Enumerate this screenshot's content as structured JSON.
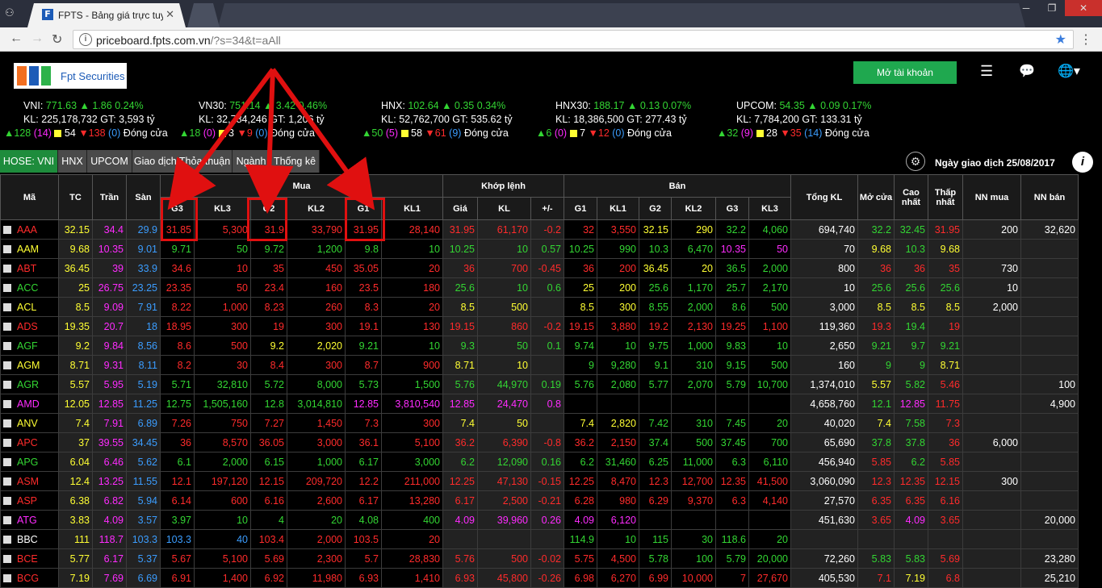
{
  "browser": {
    "tab_title": "FPTS - Bảng giá trực tuyế",
    "url_host": "priceboard.fpts.com.vn",
    "url_path": "/?s=34&t=aAll"
  },
  "header": {
    "logo_text": "Fpt Securities",
    "open_account": "Mở tài khoản"
  },
  "indices": [
    {
      "name": "VNI:",
      "value": "771.63",
      "chg": "▲ 1.86",
      "pct": "0.24%",
      "kl": "KL: 225,178,732 GT: 3,593 tỷ",
      "inc": "▲128",
      "ce": "(14)",
      "ref": "54",
      "dec": "▼138",
      "fl": "(0)",
      "status": "Đóng cửa"
    },
    {
      "name": "VN30:",
      "value": "751.14",
      "chg": "▲ 3.42",
      "pct": "0.46%",
      "kl": "KL: 32,784,246 GT: 1,206 tỷ",
      "inc": "▲18",
      "ce": "(0)",
      "ref": "3",
      "dec": "▼9",
      "fl": "(0)",
      "status": "Đóng cửa"
    },
    {
      "name": "HNX:",
      "value": "102.64",
      "chg": "▲ 0.35",
      "pct": "0.34%",
      "kl": "KL: 52,762,700 GT: 535.62 tỷ",
      "inc": "▲50",
      "ce": "(5)",
      "ref": "58",
      "dec": "▼61",
      "fl": "(9)",
      "status": "Đóng cửa"
    },
    {
      "name": "HNX30:",
      "value": "188.17",
      "chg": "▲ 0.13",
      "pct": "0.07%",
      "kl": "KL: 18,386,500 GT: 277.43 tỷ",
      "inc": "▲6",
      "ce": "(0)",
      "ref": "7",
      "dec": "▼12",
      "fl": "(0)",
      "status": "Đóng cửa"
    },
    {
      "name": "UPCOM:",
      "value": "54.35",
      "chg": "▲ 0.09",
      "pct": "0.17%",
      "kl": "KL: 7,784,200 GT: 133.31 tỷ",
      "inc": "▲32",
      "ce": "(9)",
      "ref": "28",
      "dec": "▼35",
      "fl": "(14)",
      "status": "Đóng cửa"
    }
  ],
  "tabs": [
    "HOSE: VNI",
    "HNX",
    "UPCOM",
    "Giao dịch Thỏa thuận",
    "Ngành",
    "Thống kê"
  ],
  "trade_date": "Ngày giao dịch 25/08/2017",
  "columns": {
    "ma": "Mã",
    "tc": "TC",
    "tran": "Trần",
    "san": "Sàn",
    "mua": "Mua",
    "khop": "Khớp lệnh",
    "ban": "Bán",
    "tong": "Tổng KL",
    "mo": "Mở cửa",
    "cao": "Cao nhất",
    "thap": "Thấp nhất",
    "nnmua": "NN mua",
    "nnban": "NN bán",
    "g3": "G3",
    "kl3": "KL3",
    "g2": "G2",
    "kl2": "KL2",
    "g1": "G1",
    "kl1": "KL1",
    "gia": "Giá",
    "kl": "KL",
    "pm": "+/-"
  },
  "rows": [
    [
      "AAA",
      "32.15",
      "34.4",
      "29.9",
      "31.85",
      "5,300",
      "31.9",
      "33,790",
      "31.95",
      "28,140",
      "31.95",
      "61,170",
      "-0.2",
      "32",
      "3,550",
      "32.15",
      "290",
      "32.2",
      "4,060",
      "694,740",
      "32.2",
      "32.45",
      "31.95",
      "200",
      "32,620"
    ],
    [
      "AAM",
      "9.68",
      "10.35",
      "9.01",
      "9.71",
      "50",
      "9.72",
      "1,200",
      "9.8",
      "10",
      "10.25",
      "10",
      "0.57",
      "10.25",
      "990",
      "10.3",
      "6,470",
      "10.35",
      "50",
      "70",
      "9.68",
      "10.3",
      "9.68",
      "",
      ""
    ],
    [
      "ABT",
      "36.45",
      "39",
      "33.9",
      "34.6",
      "10",
      "35",
      "450",
      "35.05",
      "20",
      "36",
      "700",
      "-0.45",
      "36",
      "200",
      "36.45",
      "20",
      "36.5",
      "2,000",
      "800",
      "36",
      "36",
      "35",
      "730",
      ""
    ],
    [
      "ACC",
      "25",
      "26.75",
      "23.25",
      "23.35",
      "50",
      "23.4",
      "160",
      "23.5",
      "180",
      "25.6",
      "10",
      "0.6",
      "25",
      "200",
      "25.6",
      "1,170",
      "25.7",
      "2,170",
      "10",
      "25.6",
      "25.6",
      "25.6",
      "10",
      ""
    ],
    [
      "ACL",
      "8.5",
      "9.09",
      "7.91",
      "8.22",
      "1,000",
      "8.23",
      "260",
      "8.3",
      "20",
      "8.5",
      "500",
      "",
      "8.5",
      "300",
      "8.55",
      "2,000",
      "8.6",
      "500",
      "3,000",
      "8.5",
      "8.5",
      "8.5",
      "2,000",
      ""
    ],
    [
      "ADS",
      "19.35",
      "20.7",
      "18",
      "18.95",
      "300",
      "19",
      "300",
      "19.1",
      "130",
      "19.15",
      "860",
      "-0.2",
      "19.15",
      "3,880",
      "19.2",
      "2,130",
      "19.25",
      "1,100",
      "119,360",
      "19.3",
      "19.4",
      "19",
      "",
      ""
    ],
    [
      "AGF",
      "9.2",
      "9.84",
      "8.56",
      "8.6",
      "500",
      "9.2",
      "2,020",
      "9.21",
      "10",
      "9.3",
      "50",
      "0.1",
      "9.74",
      "10",
      "9.75",
      "1,000",
      "9.83",
      "10",
      "2,650",
      "9.21",
      "9.7",
      "9.21",
      "",
      ""
    ],
    [
      "AGM",
      "8.71",
      "9.31",
      "8.11",
      "8.2",
      "30",
      "8.4",
      "300",
      "8.7",
      "900",
      "8.71",
      "10",
      "",
      "9",
      "9,280",
      "9.1",
      "310",
      "9.15",
      "500",
      "160",
      "9",
      "9",
      "8.71",
      "",
      ""
    ],
    [
      "AGR",
      "5.57",
      "5.95",
      "5.19",
      "5.71",
      "32,810",
      "5.72",
      "8,000",
      "5.73",
      "1,500",
      "5.76",
      "44,970",
      "0.19",
      "5.76",
      "2,080",
      "5.77",
      "2,070",
      "5.79",
      "10,700",
      "1,374,010",
      "5.57",
      "5.82",
      "5.46",
      "",
      "100"
    ],
    [
      "AMD",
      "12.05",
      "12.85",
      "11.25",
      "12.75",
      "1,505,160",
      "12.8",
      "3,014,810",
      "12.85",
      "3,810,540",
      "12.85",
      "24,470",
      "0.8",
      "",
      "",
      "",
      "",
      "",
      "",
      "4,658,760",
      "12.1",
      "12.85",
      "11.75",
      "",
      "4,900"
    ],
    [
      "ANV",
      "7.4",
      "7.91",
      "6.89",
      "7.26",
      "750",
      "7.27",
      "1,450",
      "7.3",
      "300",
      "7.4",
      "50",
      "",
      "7.4",
      "2,820",
      "7.42",
      "310",
      "7.45",
      "20",
      "40,020",
      "7.4",
      "7.58",
      "7.3",
      "",
      ""
    ],
    [
      "APC",
      "37",
      "39.55",
      "34.45",
      "36",
      "8,570",
      "36.05",
      "3,000",
      "36.1",
      "5,100",
      "36.2",
      "6,390",
      "-0.8",
      "36.2",
      "2,150",
      "37.4",
      "500",
      "37.45",
      "700",
      "65,690",
      "37.8",
      "37.8",
      "36",
      "6,000",
      ""
    ],
    [
      "APG",
      "6.04",
      "6.46",
      "5.62",
      "6.1",
      "2,000",
      "6.15",
      "1,000",
      "6.17",
      "3,000",
      "6.2",
      "12,090",
      "0.16",
      "6.2",
      "31,460",
      "6.25",
      "11,000",
      "6.3",
      "6,110",
      "456,940",
      "5.85",
      "6.2",
      "5.85",
      "",
      ""
    ],
    [
      "ASM",
      "12.4",
      "13.25",
      "11.55",
      "12.1",
      "197,120",
      "12.15",
      "209,720",
      "12.2",
      "211,000",
      "12.25",
      "47,130",
      "-0.15",
      "12.25",
      "8,470",
      "12.3",
      "12,700",
      "12.35",
      "41,500",
      "3,060,090",
      "12.3",
      "12.35",
      "12.15",
      "300",
      ""
    ],
    [
      "ASP",
      "6.38",
      "6.82",
      "5.94",
      "6.14",
      "600",
      "6.16",
      "2,600",
      "6.17",
      "13,280",
      "6.17",
      "2,500",
      "-0.21",
      "6.28",
      "980",
      "6.29",
      "9,370",
      "6.3",
      "4,140",
      "27,570",
      "6.35",
      "6.35",
      "6.16",
      "",
      ""
    ],
    [
      "ATG",
      "3.83",
      "4.09",
      "3.57",
      "3.97",
      "10",
      "4",
      "20",
      "4.08",
      "400",
      "4.09",
      "39,960",
      "0.26",
      "4.09",
      "6,120",
      "",
      "",
      "",
      "",
      "451,630",
      "3.65",
      "4.09",
      "3.65",
      "",
      "20,000"
    ],
    [
      "BBC",
      "111",
      "118.7",
      "103.3",
      "103.3",
      "40",
      "103.4",
      "2,000",
      "103.5",
      "20",
      "",
      "",
      "",
      "114.9",
      "10",
      "115",
      "30",
      "118.6",
      "20",
      "",
      "",
      "",
      "",
      "",
      ""
    ],
    [
      "BCE",
      "5.77",
      "6.17",
      "5.37",
      "5.67",
      "5,100",
      "5.69",
      "2,300",
      "5.7",
      "28,830",
      "5.76",
      "500",
      "-0.02",
      "5.75",
      "4,500",
      "5.78",
      "100",
      "5.79",
      "20,000",
      "72,260",
      "5.83",
      "5.83",
      "5.69",
      "",
      "23,280"
    ],
    [
      "BCG",
      "7.19",
      "7.69",
      "6.69",
      "6.91",
      "1,400",
      "6.92",
      "11,980",
      "6.93",
      "1,410",
      "6.93",
      "45,800",
      "-0.26",
      "6.98",
      "6,270",
      "6.99",
      "10,000",
      "7",
      "27,670",
      "405,530",
      "7.1",
      "7.19",
      "6.8",
      "",
      "25,210"
    ]
  ],
  "colors": [
    "r",
    "y",
    "c",
    "f",
    "r",
    "r",
    "r",
    "r",
    "r",
    "r",
    "r",
    "r",
    "r",
    "r",
    "r",
    "r",
    "r",
    "r",
    "r",
    "w",
    "r",
    "r",
    "r",
    "w",
    "w"
  ],
  "row_colors": [
    [
      "r",
      "y",
      "c",
      "f",
      "r",
      "r",
      "r",
      "r",
      "r",
      "r",
      "r",
      "r",
      "r",
      "r",
      "r",
      "y",
      "y",
      "g",
      "g",
      "w",
      "g",
      "g",
      "r",
      "w",
      "w"
    ],
    [
      "y",
      "y",
      "c",
      "f",
      "g",
      "g",
      "g",
      "g",
      "g",
      "g",
      "g",
      "g",
      "g",
      "g",
      "g",
      "g",
      "g",
      "c",
      "c",
      "w",
      "y",
      "g",
      "y",
      "w",
      "w"
    ],
    [
      "r",
      "y",
      "c",
      "f",
      "r",
      "r",
      "r",
      "r",
      "r",
      "r",
      "r",
      "r",
      "r",
      "r",
      "r",
      "y",
      "y",
      "g",
      "g",
      "w",
      "r",
      "r",
      "r",
      "w",
      "w"
    ],
    [
      "g",
      "y",
      "c",
      "f",
      "r",
      "r",
      "r",
      "r",
      "r",
      "r",
      "g",
      "g",
      "g",
      "y",
      "y",
      "g",
      "g",
      "g",
      "g",
      "w",
      "g",
      "g",
      "g",
      "w",
      "w"
    ],
    [
      "y",
      "y",
      "c",
      "f",
      "r",
      "r",
      "r",
      "r",
      "r",
      "r",
      "y",
      "y",
      "y",
      "y",
      "y",
      "g",
      "g",
      "g",
      "g",
      "w",
      "y",
      "y",
      "y",
      "w",
      "w"
    ],
    [
      "r",
      "y",
      "c",
      "f",
      "r",
      "r",
      "r",
      "r",
      "r",
      "r",
      "r",
      "r",
      "r",
      "r",
      "r",
      "r",
      "r",
      "r",
      "r",
      "w",
      "r",
      "g",
      "r",
      "w",
      "w"
    ],
    [
      "g",
      "y",
      "c",
      "f",
      "r",
      "r",
      "y",
      "y",
      "g",
      "g",
      "g",
      "g",
      "g",
      "g",
      "g",
      "g",
      "g",
      "g",
      "g",
      "w",
      "g",
      "g",
      "g",
      "w",
      "w"
    ],
    [
      "y",
      "y",
      "c",
      "f",
      "r",
      "r",
      "r",
      "r",
      "r",
      "r",
      "y",
      "y",
      "y",
      "g",
      "g",
      "g",
      "g",
      "g",
      "g",
      "w",
      "g",
      "g",
      "y",
      "w",
      "w"
    ],
    [
      "g",
      "y",
      "c",
      "f",
      "g",
      "g",
      "g",
      "g",
      "g",
      "g",
      "g",
      "g",
      "g",
      "g",
      "g",
      "g",
      "g",
      "g",
      "g",
      "w",
      "y",
      "g",
      "r",
      "w",
      "w"
    ],
    [
      "c",
      "y",
      "c",
      "f",
      "g",
      "g",
      "g",
      "g",
      "c",
      "c",
      "c",
      "c",
      "c",
      "w",
      "w",
      "w",
      "w",
      "w",
      "w",
      "w",
      "g",
      "c",
      "r",
      "w",
      "w"
    ],
    [
      "y",
      "y",
      "c",
      "f",
      "r",
      "r",
      "r",
      "r",
      "r",
      "r",
      "y",
      "y",
      "y",
      "y",
      "y",
      "g",
      "g",
      "g",
      "g",
      "w",
      "y",
      "g",
      "r",
      "w",
      "w"
    ],
    [
      "r",
      "y",
      "c",
      "f",
      "r",
      "r",
      "r",
      "r",
      "r",
      "r",
      "r",
      "r",
      "r",
      "r",
      "r",
      "g",
      "g",
      "g",
      "g",
      "w",
      "g",
      "g",
      "r",
      "w",
      "w"
    ],
    [
      "g",
      "y",
      "c",
      "f",
      "g",
      "g",
      "g",
      "g",
      "g",
      "g",
      "g",
      "g",
      "g",
      "g",
      "g",
      "g",
      "g",
      "g",
      "g",
      "w",
      "r",
      "g",
      "r",
      "w",
      "w"
    ],
    [
      "r",
      "y",
      "c",
      "f",
      "r",
      "r",
      "r",
      "r",
      "r",
      "r",
      "r",
      "r",
      "r",
      "r",
      "r",
      "r",
      "r",
      "r",
      "r",
      "w",
      "r",
      "r",
      "r",
      "w",
      "w"
    ],
    [
      "r",
      "y",
      "c",
      "f",
      "r",
      "r",
      "r",
      "r",
      "r",
      "r",
      "r",
      "r",
      "r",
      "r",
      "r",
      "r",
      "r",
      "r",
      "r",
      "w",
      "r",
      "r",
      "r",
      "w",
      "w"
    ],
    [
      "c",
      "y",
      "c",
      "f",
      "g",
      "g",
      "g",
      "g",
      "g",
      "g",
      "c",
      "c",
      "c",
      "c",
      "c",
      "w",
      "w",
      "w",
      "w",
      "w",
      "r",
      "c",
      "r",
      "w",
      "w"
    ],
    [
      "w",
      "y",
      "c",
      "f",
      "f",
      "f",
      "r",
      "r",
      "r",
      "r",
      "w",
      "w",
      "w",
      "g",
      "g",
      "g",
      "g",
      "g",
      "g",
      "w",
      "w",
      "w",
      "w",
      "w",
      "w"
    ],
    [
      "r",
      "y",
      "c",
      "f",
      "r",
      "r",
      "r",
      "r",
      "r",
      "r",
      "r",
      "r",
      "r",
      "r",
      "r",
      "g",
      "g",
      "g",
      "g",
      "w",
      "g",
      "g",
      "r",
      "w",
      "w"
    ],
    [
      "r",
      "y",
      "c",
      "f",
      "r",
      "r",
      "r",
      "r",
      "r",
      "r",
      "r",
      "r",
      "r",
      "r",
      "r",
      "r",
      "r",
      "r",
      "r",
      "w",
      "r",
      "y",
      "r",
      "w",
      "w"
    ]
  ]
}
